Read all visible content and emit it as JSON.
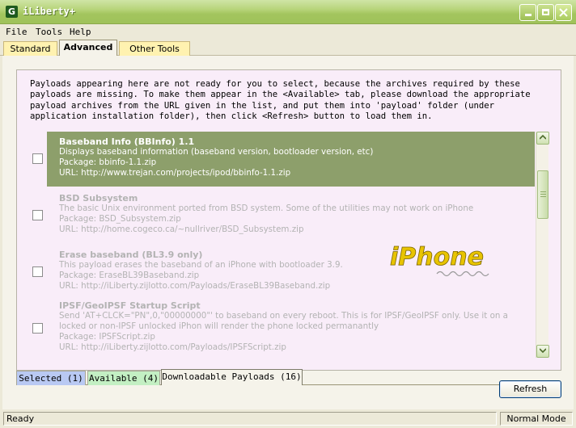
{
  "window": {
    "title": "iLiberty+",
    "icon_letter": "G",
    "min_icon": "minimize-icon",
    "max_icon": "maximize-icon",
    "close_icon": "close-icon"
  },
  "menu": {
    "items": [
      "File",
      "Tools",
      "Help"
    ]
  },
  "top_tabs": {
    "standard": "Standard",
    "advanced": "Advanced",
    "other": "Other Tools",
    "active": "Advanced"
  },
  "description": "Payloads appearing here are not ready for you to select, because the archives required by these payloads are missing. To make them appear in the <Available> tab, please download the appropriate payload archives from the URL given in the list, and put them into 'payload' folder (under application installation folder), then click <Refresh> button to load them in.",
  "payloads": [
    {
      "name": "Baseband Info (BBInfo) 1.1",
      "desc": "Displays baseband information (baseband version, bootloader version, etc)",
      "package": "Package: bbinfo-1.1.zip",
      "url": "URL: http://www.trejan.com/projects/ipod/bbinfo-1.1.zip",
      "selected": true
    },
    {
      "name": "BSD Subsystem",
      "desc": "The basic Unix environment ported from BSD system. Some of the utilities may not work on iPhone",
      "package": "Package: BSD_Subsystem.zip",
      "url": "URL: http://home.cogeco.ca/~nullriver/BSD_Subsystem.zip",
      "selected": false
    },
    {
      "name": "Erase baseband (BL3.9 only)",
      "desc": "This payload erases the baseband of an iPhone with bootloader 3.9.",
      "package": "Package: EraseBL39Baseband.zip",
      "url": "URL: http://iLiberty.zijlotto.com/Payloads/EraseBL39Baseband.zip",
      "selected": false
    },
    {
      "name": "IPSF/GeoIPSF Startup Script",
      "desc": "Send 'AT+CLCK=\"PN\",0,\"00000000\"' to baseband on every reboot. This is for IPSF/GeoIPSF only. Use it on a locked or non-IPSF unlocked iPhon will render the phone locked permanantly",
      "package": "Package: IPSFScript.zip",
      "url": "URL: http://iLiberty.zijlotto.com/Payloads/IPSFScript.zip",
      "selected": false
    }
  ],
  "logo": {
    "text": "iPhone",
    "color": "#e8c400"
  },
  "bottom_tabs": {
    "selected": "Selected (1)",
    "available": "Available (4)",
    "downloadable": "Downloadable Payloads (16)"
  },
  "buttons": {
    "refresh": "Refresh"
  },
  "status": {
    "left": "Ready",
    "right": "Normal Mode"
  },
  "colors": {
    "selected_row": "#8d9f6b",
    "content_bg": "#f9edf9",
    "tab_selected": "#b9c9f3",
    "tab_available": "#c3efc3"
  }
}
